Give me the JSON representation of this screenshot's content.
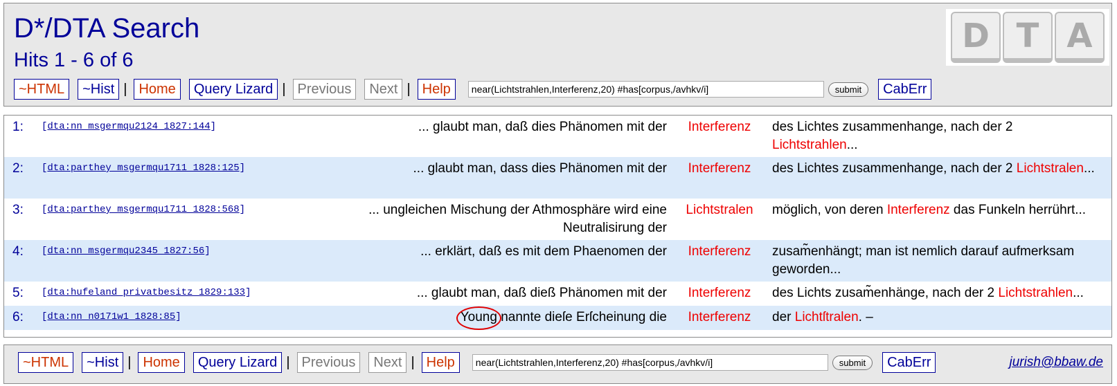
{
  "header": {
    "title": "D*/DTA Search",
    "hits": "Hits 1 - 6 of 6",
    "logo_letters": [
      "D",
      "T",
      "A"
    ]
  },
  "nav": {
    "html": "~HTML",
    "hist": "~Hist",
    "home": "Home",
    "lizard": "Query Lizard",
    "previous": "Previous",
    "next": "Next",
    "help": "Help",
    "separator": "|",
    "query_value": "near(Lichtstrahlen,Interferenz,20) #has[corpus,/avhkv/i]",
    "submit": "submit",
    "caberr": "CabErr"
  },
  "footer": {
    "email": "jurish@bbaw.de"
  },
  "colors": {
    "title": "#000099",
    "highlight": "#ee0000",
    "row_alt": "#dbeafa"
  },
  "results": [
    {
      "num": "1:",
      "source": "dta:nn_msgermqu2124_1827:144",
      "left": "... glaubt man, daß dies Phänomen mit der",
      "kw": "Interferenz",
      "right_pre": "des Lichtes zusammenhange, nach der 2 ",
      "right_hl": "Lichtstrahlen",
      "right_post": "..."
    },
    {
      "num": "2:",
      "source": "dta:parthey_msgermqu1711_1828:125",
      "left": "... glaubt man, dass dies Phänomen mit der",
      "kw": "Interferenz",
      "right_pre": "des Lichtes zusammenhange, nach der 2 ",
      "right_hl": "Lichtstralen",
      "right_post": "..."
    },
    {
      "num": "3:",
      "source": "dta:parthey_msgermqu1711_1828:568",
      "left": "... ungleichen Mischung der Athmosphäre wird eine Neutralisirung der",
      "kw": "Lichtstralen",
      "right_pre": "möglich, von deren ",
      "right_hl": "Interferenz",
      "right_post": " das Funkeln herrührt..."
    },
    {
      "num": "4:",
      "source": "dta:nn_msgermqu2345_1827:56",
      "left": "... erklärt, daß es mit dem Phaenomen der",
      "kw": "Interferenz",
      "right_pre": "zusam̃enhängt; man ist nemlich darauf aufmerksam geworden...",
      "right_hl": "",
      "right_post": ""
    },
    {
      "num": "5:",
      "source": "dta:hufeland_privatbesitz_1829:133",
      "left": "... glaubt man, daß dieß Phänomen mit der",
      "kw": "Interferenz",
      "right_pre": "des Lichts zusam̃enhänge, nach der 2 ",
      "right_hl": "Lichtstrahlen",
      "right_post": "..."
    },
    {
      "num": "6:",
      "source": "dta:nn_n0171w1_1828:85",
      "left_circled": "Young",
      "left": " nannte dieſe Erſcheinung die",
      "kw": "Interferenz",
      "right_pre": "der ",
      "right_hl": "Lichtſtralen",
      "right_post": ". –"
    }
  ]
}
